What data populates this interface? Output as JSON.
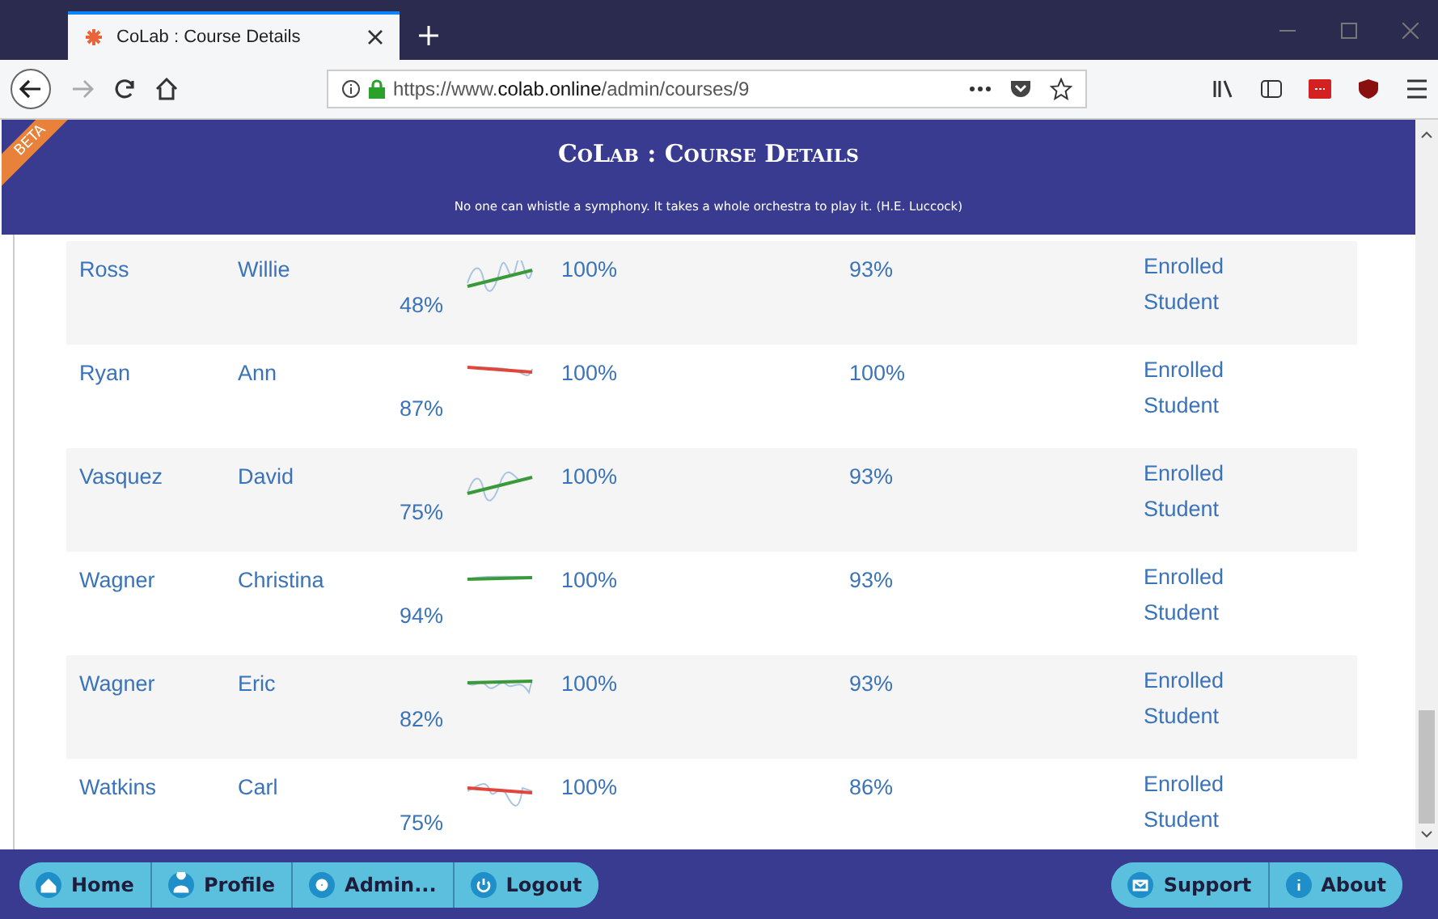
{
  "browser": {
    "tab_title": "CoLab : Course Details",
    "url_prefix": "https://www.",
    "url_domain": "colab.online",
    "url_path": "/admin/courses/9"
  },
  "header": {
    "ribbon": "BETA",
    "title": "CoLab : Course Details",
    "quote": "No one can whistle a symphony. It takes a whole orchestra to play it. (H.E. Luccock)"
  },
  "rows": [
    {
      "last": "Ross",
      "first": "Willie",
      "score": "48%",
      "color": "#3a9a3a",
      "col_4": "100%",
      "col_5": "93%",
      "role": "Enrolled Student"
    },
    {
      "last": "Ryan",
      "first": "Ann",
      "score": "87%",
      "color": "#e0463a",
      "col_4": "100%",
      "col_5": "100%",
      "role": "Enrolled Student"
    },
    {
      "last": "Vasquez",
      "first": "David",
      "score": "75%",
      "color": "#3a9a3a",
      "col_4": "100%",
      "col_5": "93%",
      "role": "Enrolled Student"
    },
    {
      "last": "Wagner",
      "first": "Christina",
      "score": "94%",
      "color": "#3a9a3a",
      "col_4": "100%",
      "col_5": "93%",
      "role": "Enrolled Student"
    },
    {
      "last": "Wagner",
      "first": "Eric",
      "score": "82%",
      "color": "#3a9a3a",
      "col_4": "100%",
      "col_5": "93%",
      "role": "Enrolled Student"
    },
    {
      "last": "Watkins",
      "first": "Carl",
      "score": "75%",
      "color": "#e0463a",
      "col_4": "100%",
      "col_5": "86%",
      "role": "Enrolled Student"
    }
  ],
  "footer": {
    "left": [
      {
        "label": "Home"
      },
      {
        "label": "Profile"
      },
      {
        "label": "Admin..."
      },
      {
        "label": "Logout"
      }
    ],
    "right": [
      {
        "label": "Support"
      },
      {
        "label": "About"
      }
    ]
  }
}
